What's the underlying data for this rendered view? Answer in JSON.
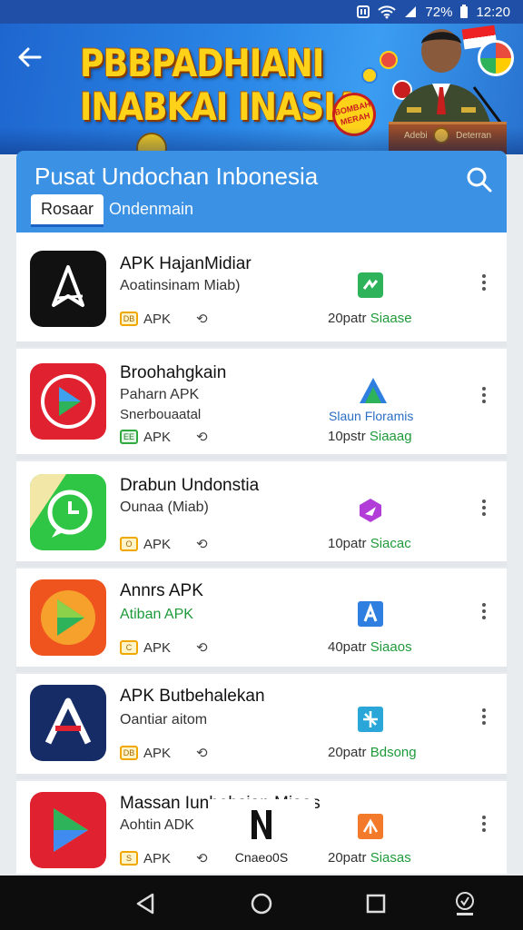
{
  "status_bar": {
    "battery": "72%",
    "time": "12:20"
  },
  "banner": {
    "title_line1": "PBBPADHIANI",
    "title_line2": "INABKAI INASIA",
    "badge_text": "BOMBAH MERAH",
    "podium_text_left": "Adebi",
    "podium_text_right": "Deterran"
  },
  "header": {
    "title": "Pusat Undochan Inbonesia",
    "tabs": [
      {
        "label": "Rosaar"
      },
      {
        "label": "Ondenmain"
      }
    ]
  },
  "apps": [
    {
      "name": "APK HajanMidiar",
      "line1": "Aoatinsinam Miab)",
      "line2": "",
      "type": "APK",
      "stat_num": "20patr",
      "stat_label": "Siaase",
      "dev_text": "",
      "dev_logo": "green"
    },
    {
      "name": "Broohahgkain",
      "line1": "Paharn APK",
      "line2": "Snerbouaatal",
      "type": "APK",
      "stat_num": "10pstr",
      "stat_label": "Siaaag",
      "dev_text": "Slaun Floramis",
      "dev_logo": "blue-green"
    },
    {
      "name": "Drabun Undonstia",
      "line1": "Ounaa (Miab)",
      "line2": "",
      "type": "APK",
      "stat_num": "10patr",
      "stat_label": "Siacac",
      "dev_text": "",
      "dev_logo": "purple"
    },
    {
      "name": "Annrs APK",
      "line1": "Atiban APK",
      "line2": "",
      "type": "APK",
      "stat_num": "40patr",
      "stat_label": "Siaaos",
      "dev_text": "",
      "dev_logo": "blue"
    },
    {
      "name": "APK Butbehalekan",
      "line1": "Oantiar aitom",
      "line2": "",
      "type": "APK",
      "stat_num": "20patr",
      "stat_label": "Bdsong",
      "dev_text": "",
      "dev_logo": "teal"
    },
    {
      "name": "Massan Iunhobsian Miaas",
      "line1": "Aohtin ADK",
      "line2": "",
      "type": "APK",
      "stat_num": "20patr",
      "stat_label": "Siasas",
      "dev_text": "",
      "dev_logo": "orange"
    }
  ],
  "overlay": {
    "label": "Cnaeo0S"
  },
  "colors": {
    "accent_blue": "#3b91e3",
    "status_green": "#1f9a3a",
    "banner_yellow": "#ffd21a"
  }
}
